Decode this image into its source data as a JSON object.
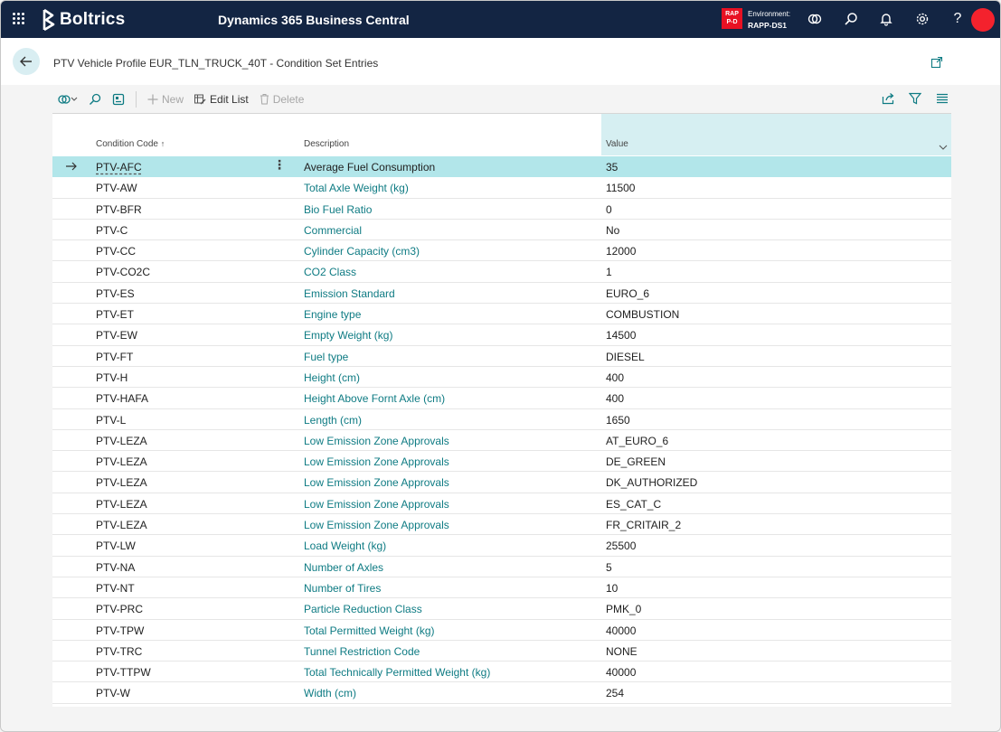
{
  "topbar": {
    "brand": "Boltrics",
    "product": "Dynamics 365 Business Central",
    "env_badge": "RAP P-D",
    "env_label": "Environment:",
    "env_name": "RAPP-DS1",
    "icons": [
      "waffle-icon",
      "copilot-icon",
      "search-icon",
      "bell-icon",
      "gear-icon",
      "help-icon",
      "avatar"
    ]
  },
  "page": {
    "title": "PTV Vehicle Profile EUR_TLN_TRUCK_40T - Condition Set Entries"
  },
  "toolbar": {
    "new_label": "New",
    "edit_list_label": "Edit List",
    "delete_label": "Delete"
  },
  "grid": {
    "columns": {
      "code": "Condition Code",
      "description": "Description",
      "value": "Value"
    },
    "rows": [
      {
        "code": "PTV-AFC",
        "description": "Average Fuel Consumption",
        "value": "35"
      },
      {
        "code": "PTV-AW",
        "description": "Total Axle Weight (kg)",
        "value": "11500"
      },
      {
        "code": "PTV-BFR",
        "description": "Bio Fuel Ratio",
        "value": "0"
      },
      {
        "code": "PTV-C",
        "description": "Commercial",
        "value": "No"
      },
      {
        "code": "PTV-CC",
        "description": "Cylinder Capacity (cm3)",
        "value": "12000"
      },
      {
        "code": "PTV-CO2C",
        "description": "CO2 Class",
        "value": "1"
      },
      {
        "code": "PTV-ES",
        "description": "Emission Standard",
        "value": "EURO_6"
      },
      {
        "code": "PTV-ET",
        "description": "Engine type",
        "value": "COMBUSTION"
      },
      {
        "code": "PTV-EW",
        "description": "Empty Weight (kg)",
        "value": "14500"
      },
      {
        "code": "PTV-FT",
        "description": "Fuel type",
        "value": "DIESEL"
      },
      {
        "code": "PTV-H",
        "description": "Height (cm)",
        "value": "400"
      },
      {
        "code": "PTV-HAFA",
        "description": "Height Above Fornt Axle (cm)",
        "value": "400"
      },
      {
        "code": "PTV-L",
        "description": "Length (cm)",
        "value": "1650"
      },
      {
        "code": "PTV-LEZA",
        "description": "Low Emission Zone Approvals",
        "value": "AT_EURO_6"
      },
      {
        "code": "PTV-LEZA",
        "description": "Low Emission Zone Approvals",
        "value": "DE_GREEN"
      },
      {
        "code": "PTV-LEZA",
        "description": "Low Emission Zone Approvals",
        "value": "DK_AUTHORIZED"
      },
      {
        "code": "PTV-LEZA",
        "description": "Low Emission Zone Approvals",
        "value": "ES_CAT_C"
      },
      {
        "code": "PTV-LEZA",
        "description": "Low Emission Zone Approvals",
        "value": "FR_CRITAIR_2"
      },
      {
        "code": "PTV-LW",
        "description": "Load Weight (kg)",
        "value": "25500"
      },
      {
        "code": "PTV-NA",
        "description": "Number of Axles",
        "value": "5"
      },
      {
        "code": "PTV-NT",
        "description": "Number of Tires",
        "value": "10"
      },
      {
        "code": "PTV-PRC",
        "description": "Particle Reduction Class",
        "value": "PMK_0"
      },
      {
        "code": "PTV-TPW",
        "description": "Total Permitted Weight (kg)",
        "value": "40000"
      },
      {
        "code": "PTV-TRC",
        "description": "Tunnel Restriction Code",
        "value": "NONE"
      },
      {
        "code": "PTV-TTPW",
        "description": "Total Technically Permitted Weight (kg)",
        "value": "40000"
      },
      {
        "code": "PTV-W",
        "description": "Width (cm)",
        "value": "254"
      }
    ],
    "selected_index": 0
  },
  "colors": {
    "topbar": "#132543",
    "accent_link": "#0e7b83",
    "selected_row": "#b2e6ea",
    "env_badge": "#e81123",
    "avatar": "#f4222d"
  }
}
